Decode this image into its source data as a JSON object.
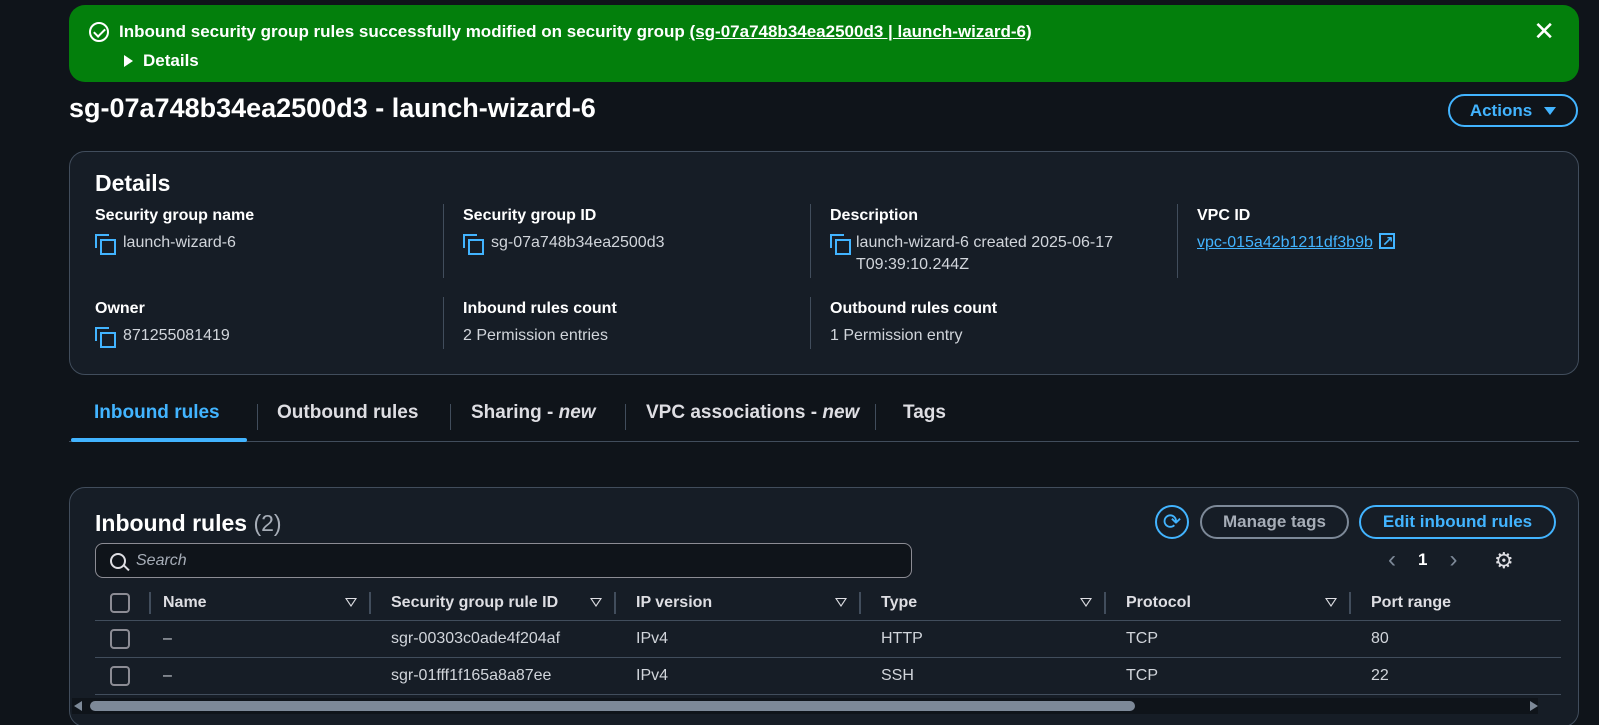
{
  "banner": {
    "message": "Inbound security group rules successfully modified on security group ",
    "link": "(sg-07a748b34ea2500d3 | launch-wizard-6)",
    "details_label": "Details",
    "close": "✕"
  },
  "page_title": "sg-07a748b34ea2500d3 - launch-wizard-6",
  "actions_label": "Actions",
  "details": {
    "heading": "Details",
    "sg_name_label": "Security group name",
    "sg_name": "launch-wizard-6",
    "sg_id_label": "Security group ID",
    "sg_id": "sg-07a748b34ea2500d3",
    "description_label": "Description",
    "description": "launch-wizard-6 created 2025-06-17 T09:39:10.244Z",
    "vpc_id_label": "VPC ID",
    "vpc_id": "vpc-015a42b1211df3b9b",
    "owner_label": "Owner",
    "owner": "871255081419",
    "inbound_count_label": "Inbound rules count",
    "inbound_count": "2 Permission entries",
    "outbound_count_label": "Outbound rules count",
    "outbound_count": "1 Permission entry"
  },
  "tabs": [
    {
      "label": "Inbound rules"
    },
    {
      "label": "Outbound rules"
    },
    {
      "label": "Sharing - ",
      "badge": "new"
    },
    {
      "label": "VPC associations - ",
      "badge": "new"
    },
    {
      "label": "Tags"
    }
  ],
  "rules": {
    "heading": "Inbound rules",
    "count": "(2)",
    "manage_tags": "Manage tags",
    "edit": "Edit inbound rules",
    "search_placeholder": "Search",
    "page": "1",
    "columns": [
      "Name",
      "Security group rule ID",
      "IP version",
      "Type",
      "Protocol",
      "Port range"
    ],
    "rows": [
      [
        "–",
        "sgr-00303c0ade4f204af",
        "IPv4",
        "HTTP",
        "TCP",
        "80"
      ],
      [
        "–",
        "sgr-01fff1f165a8a87ee",
        "IPv4",
        "SSH",
        "TCP",
        "22"
      ]
    ]
  },
  "colors": {
    "accent": "#42b4ff",
    "success": "#037f0c",
    "background": "#0f141a"
  }
}
